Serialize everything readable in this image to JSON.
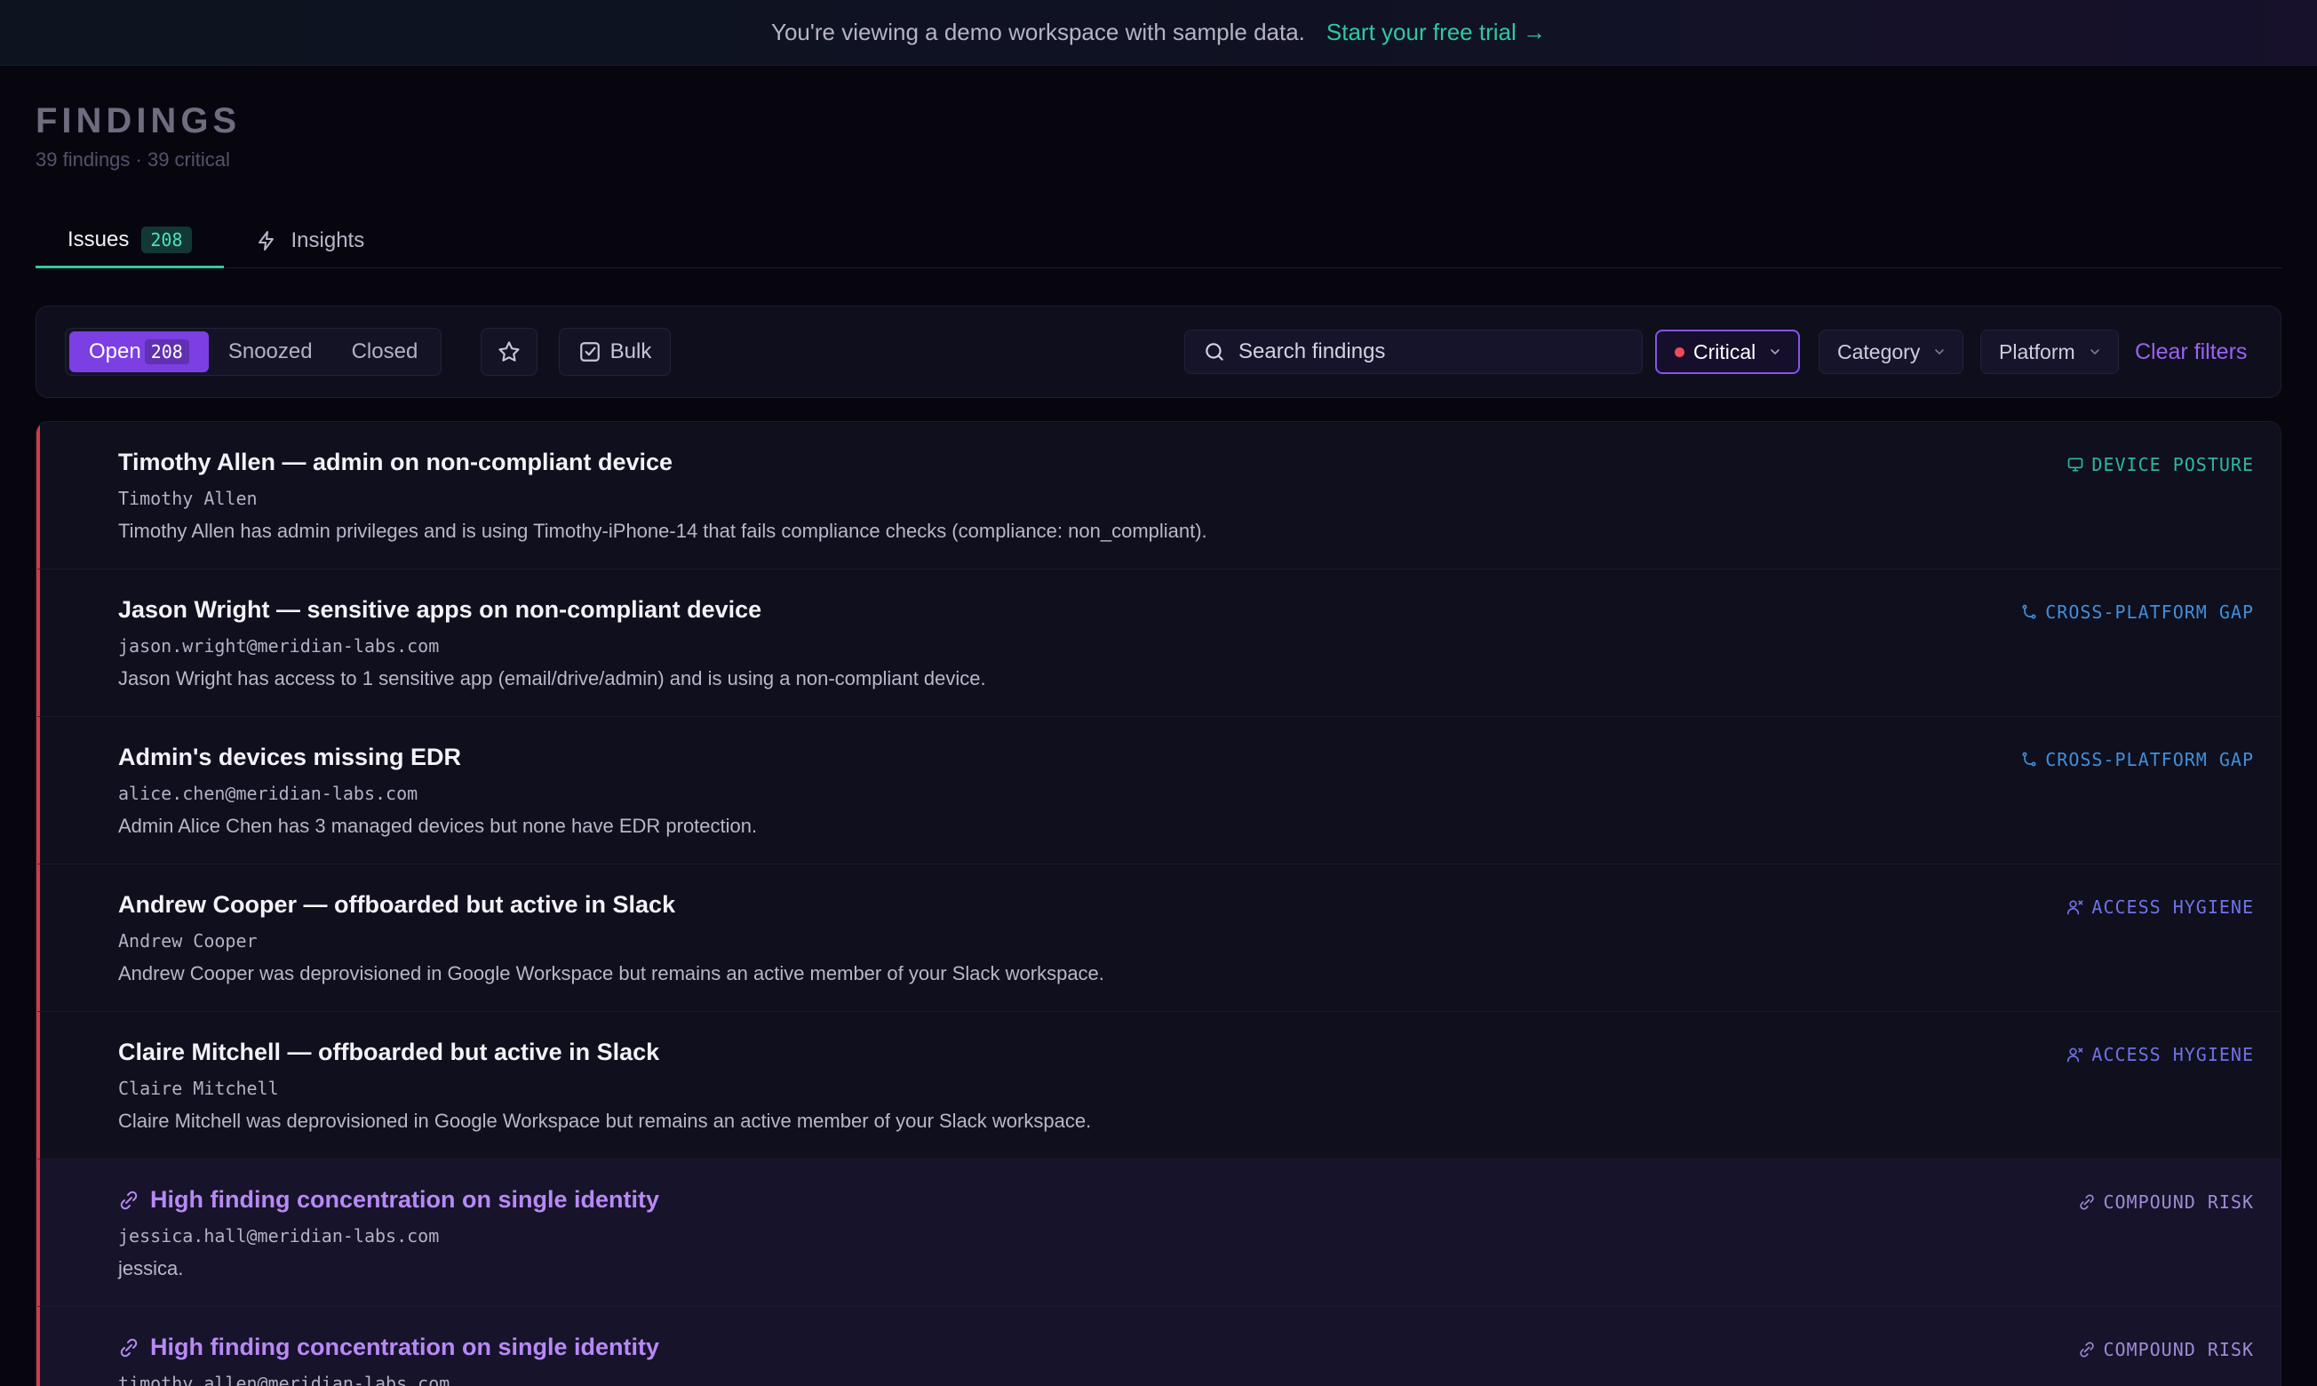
{
  "banner": {
    "message": "You're viewing a demo workspace with sample data.",
    "cta": "Start your free trial →"
  },
  "page": {
    "title": "FINDINGS",
    "subtitle": "39 findings · 39 critical"
  },
  "tabs": [
    {
      "label": "Issues",
      "count": "208"
    },
    {
      "label": "Insights"
    }
  ],
  "toolbar": {
    "status": [
      {
        "label": "Open",
        "count": "208"
      },
      {
        "label": "Snoozed"
      },
      {
        "label": "Closed"
      }
    ],
    "bulk_label": "Bulk",
    "search_placeholder": "Search findings",
    "severity_filter": "Critical",
    "category_filter": "Category",
    "platform_filter": "Platform",
    "clear_label": "Clear filters"
  },
  "colors": {
    "device_posture": "#2cb8a0",
    "cross_platform_gap": "#3f8fdc",
    "access_hygiene": "#6f72e8",
    "compound_risk": "#a08bd6",
    "severity_critical": "#d2394a",
    "accent": "#7b3fe4"
  },
  "findings": [
    {
      "title": "Timothy Allen — admin on non-compliant device",
      "subject": "Timothy Allen",
      "description": "Timothy Allen has admin privileges and is using Timothy-iPhone-14 that fails compliance checks (compliance: non_compliant).",
      "category": "DEVICE POSTURE",
      "category_icon": "monitor-icon"
    },
    {
      "title": "Jason Wright — sensitive apps on non-compliant device",
      "subject": "jason.wright@meridian-labs.com",
      "description": "Jason Wright has access to 1 sensitive app (email/drive/admin) and is using a non-compliant device.",
      "category": "CROSS-PLATFORM GAP",
      "category_icon": "git-branch-icon"
    },
    {
      "title": "Admin's devices missing EDR",
      "subject": "alice.chen@meridian-labs.com",
      "description": "Admin Alice Chen has 3 managed devices but none have EDR protection.",
      "category": "CROSS-PLATFORM GAP",
      "category_icon": "git-branch-icon"
    },
    {
      "title": "Andrew Cooper — offboarded but active in Slack",
      "subject": "Andrew Cooper",
      "description": "Andrew Cooper was deprovisioned in Google Workspace but remains an active member of your Slack workspace.",
      "category": "ACCESS HYGIENE",
      "category_icon": "user-x-icon"
    },
    {
      "title": "Claire Mitchell — offboarded but active in Slack",
      "subject": "Claire Mitchell",
      "description": "Claire Mitchell was deprovisioned in Google Workspace but remains an active member of your Slack workspace.",
      "category": "ACCESS HYGIENE",
      "category_icon": "user-x-icon"
    },
    {
      "title": "High finding concentration on single identity",
      "subject": "jessica.hall@meridian-labs.com",
      "description": "jessica.",
      "category": "COMPOUND RISK",
      "category_icon": "link-icon"
    },
    {
      "title": "High finding concentration on single identity",
      "subject": "timothy.allen@meridian-labs.com",
      "description": "",
      "category": "COMPOUND RISK",
      "category_icon": "link-icon"
    }
  ]
}
